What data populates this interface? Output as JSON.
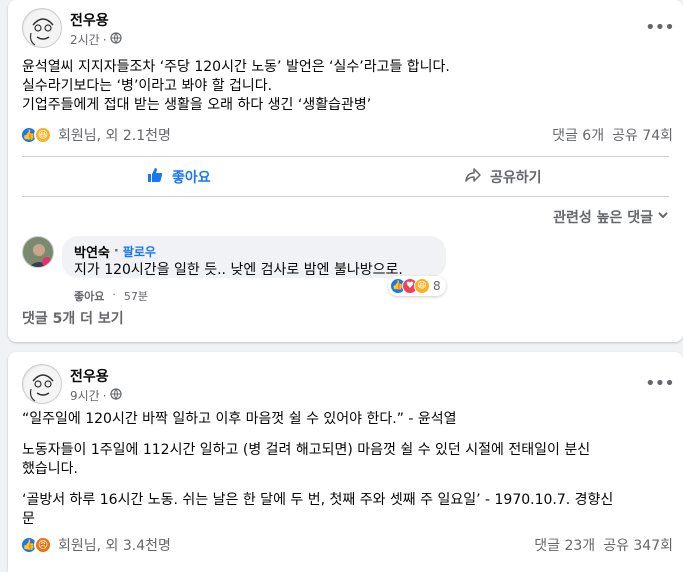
{
  "post1": {
    "author": "전우용",
    "time": "2시간",
    "paragraph": [
      "윤석열씨 지지자들조차 ‘주당 120시간 노동’ 발언은 ‘실수’라고들 합니다.",
      "실수라기보다는 ‘병’이라고 봐야 할 겁니다.",
      "기업주들에게 접대 받는 생활을 오래 하다 생긴 ‘생활습관병’"
    ],
    "reactions_text": "회원님, 외 2.1천명",
    "comments": "댓글 6개",
    "shares": "공유 74회",
    "like_label": "좋아요",
    "share_label": "공유하기",
    "sort_label": "관련성 높은 댓글",
    "comment": {
      "author": "박연숙",
      "follow": "팔로우",
      "text": "지가 120시간을 일한 듯.. 낮엔 검사로 밤엔 불나방으로.",
      "like": "좋아요",
      "time": "57분",
      "reaction_count": "8"
    },
    "more_comments": "댓글 5개 더 보기"
  },
  "post2": {
    "author": "전우용",
    "time": "9시간",
    "p1": "“일주일에 120시간 바짝 일하고 이후 마음껏 쉴 수 있어야 한다.” - 윤석열",
    "p2a": "노동자들이 1주일에 112시간 일하고 (병 걸려 해고되면) 마음껏 쉴 수 있던 시절에 전태일이 분신",
    "p2b": "했습니다.",
    "p3a": "‘골방서 하루 16시간 노동. 쉬는 날은 한 달에 두 번, 첫째 주와 셋째 주 일요일’ - 1970.10.7. 경향신",
    "p3b": "문",
    "reactions_text": "회원님, 외 3.4천명",
    "comments": "댓글 23개",
    "shares": "공유 347회"
  }
}
